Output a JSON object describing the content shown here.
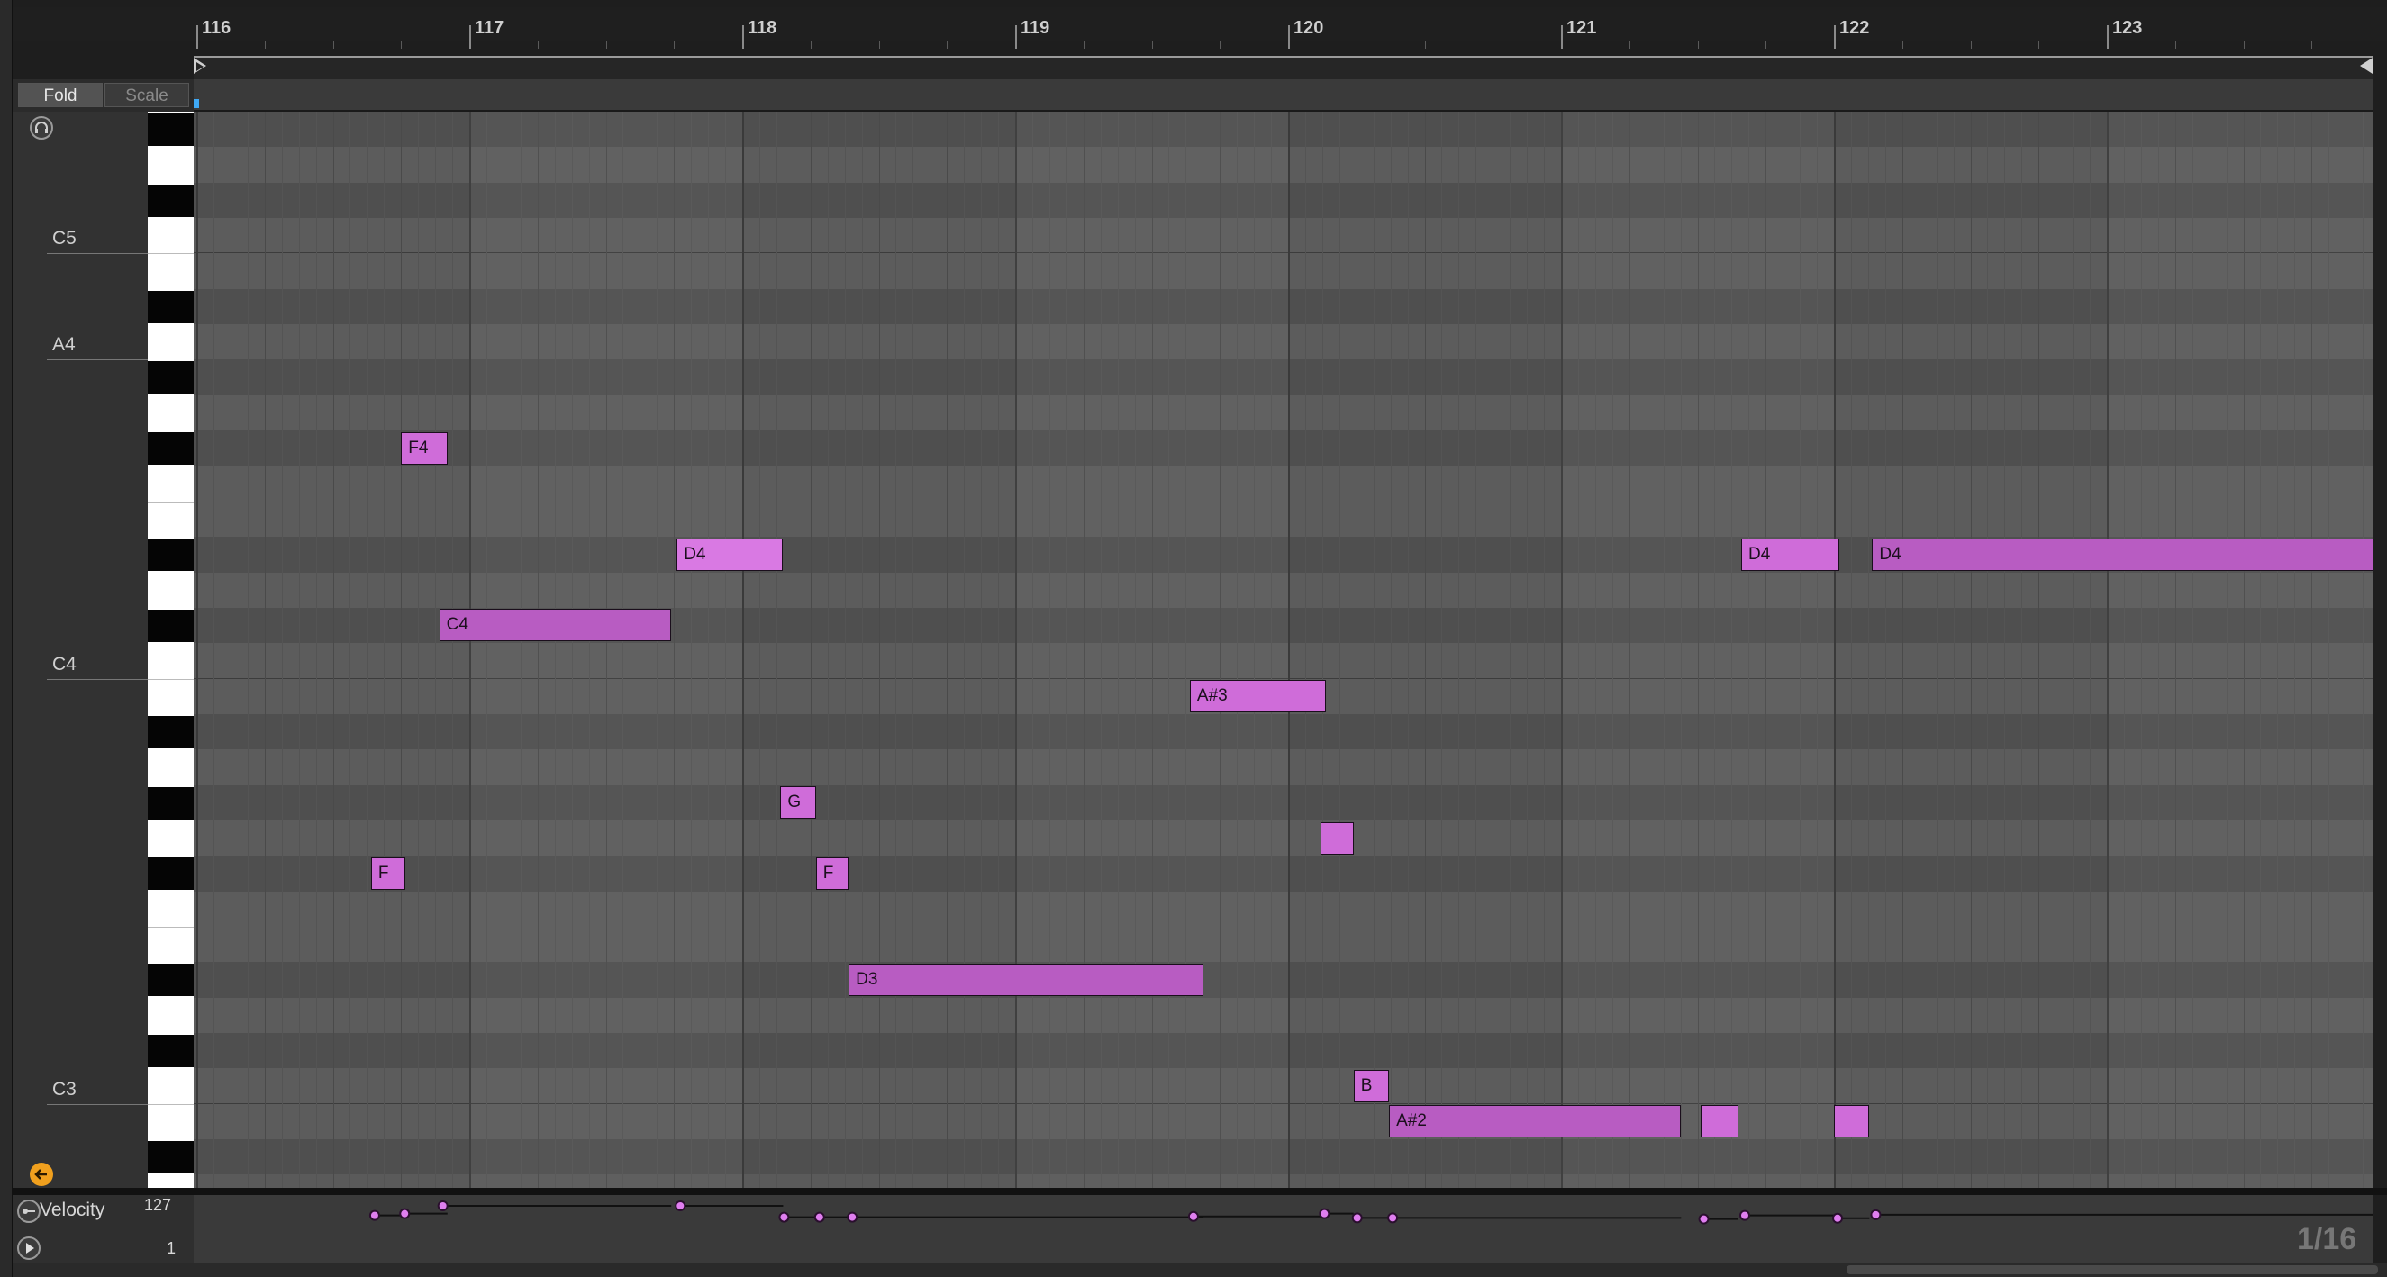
{
  "ruler": {
    "bars": [
      "116",
      "117",
      "118",
      "119",
      "120",
      "121",
      "122",
      "123"
    ]
  },
  "header": {
    "fold_label": "Fold",
    "scale_label": "Scale"
  },
  "keyboard": {
    "octave_labels": [
      {
        "label": "C5",
        "row": 3
      },
      {
        "label": "A4",
        "row": 6
      },
      {
        "label": "C4",
        "row": 15
      },
      {
        "label": "C3",
        "row": 27
      }
    ]
  },
  "notes": [
    {
      "label": "F",
      "start": 116.64,
      "dur": 0.125,
      "row": 21
    },
    {
      "label": "F4",
      "start": 116.75,
      "dur": 0.17,
      "row": 9
    },
    {
      "label": "C4",
      "start": 116.89,
      "dur": 0.85,
      "row": 14
    },
    {
      "label": "D4",
      "start": 117.76,
      "dur": 0.39,
      "row": 12
    },
    {
      "label": "G",
      "start": 118.14,
      "dur": 0.13,
      "row": 19
    },
    {
      "label": "F",
      "start": 118.27,
      "dur": 0.12,
      "row": 21
    },
    {
      "label": "D3",
      "start": 118.39,
      "dur": 1.3,
      "row": 24
    },
    {
      "label": "A#3",
      "start": 119.64,
      "dur": 0.5,
      "row": 16
    },
    {
      "label": "",
      "start": 120.12,
      "dur": 0.12,
      "row": 20
    },
    {
      "label": "B",
      "start": 120.24,
      "dur": 0.13,
      "row": 27
    },
    {
      "label": "A#2",
      "start": 120.37,
      "dur": 1.07,
      "row": 28
    },
    {
      "label": "",
      "start": 121.51,
      "dur": 0.14,
      "row": 28
    },
    {
      "label": "D4",
      "start": 121.66,
      "dur": 0.36,
      "row": 12
    },
    {
      "label": "",
      "start": 122.0,
      "dur": 0.13,
      "row": 28
    },
    {
      "label": "D4",
      "start": 122.14,
      "dur": 1.86,
      "row": 12
    }
  ],
  "velocity": {
    "title": "Velocity",
    "max_label": "127",
    "min_label": "1",
    "values": [
      100,
      105,
      127,
      127,
      95,
      95,
      95,
      97,
      105,
      93,
      93,
      90,
      100,
      92,
      102
    ]
  },
  "grid_resolution": "1/16",
  "colors": {
    "note_light": "#cf6cd9",
    "note_dark": "#b85cc2",
    "selected_note": "#d979e3",
    "velocity_point": "#e07ef0"
  }
}
